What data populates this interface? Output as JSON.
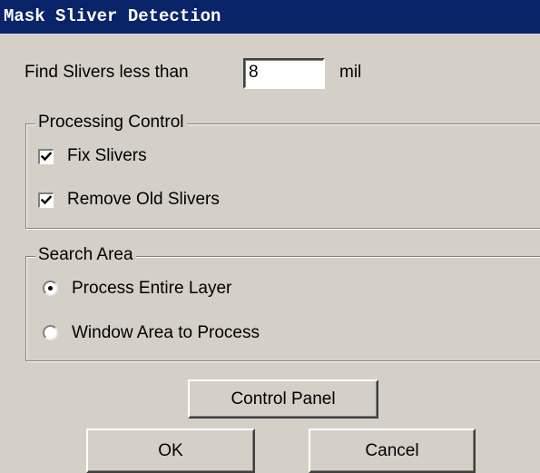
{
  "window": {
    "title": "Mask Sliver Detection"
  },
  "find": {
    "label": "Find Slivers less than",
    "value": "8",
    "unit": "mil"
  },
  "processing_control": {
    "legend": "Processing Control",
    "fix_slivers": {
      "label": "Fix Slivers",
      "checked": true
    },
    "remove_old_slivers": {
      "label": "Remove Old Slivers",
      "checked": true
    }
  },
  "search_area": {
    "legend": "Search Area",
    "options": [
      {
        "label": "Process Entire Layer",
        "selected": true
      },
      {
        "label": "Window Area to Process",
        "selected": false
      }
    ]
  },
  "buttons": {
    "control_panel": "Control Panel",
    "ok": "OK",
    "cancel": "Cancel"
  }
}
